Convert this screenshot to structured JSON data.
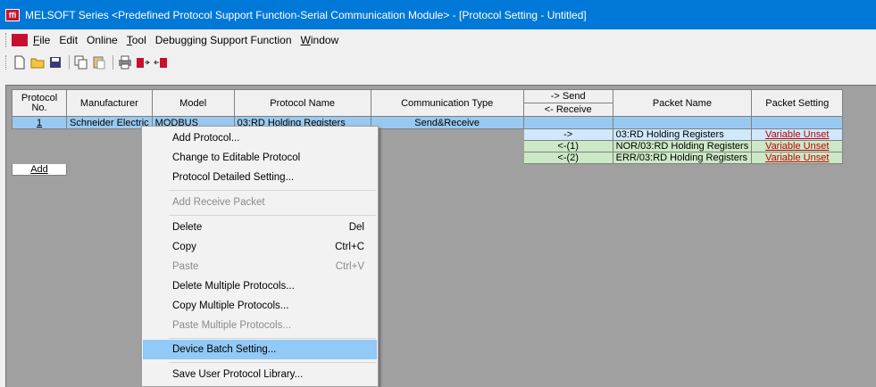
{
  "window": {
    "title": "MELSOFT Series <Predefined Protocol Support Function-Serial Communication Module> - [Protocol Setting - Untitled]",
    "icon": "melsoft-app-icon",
    "icon_glyph": "ffi"
  },
  "menubar": {
    "items": [
      {
        "key": "F",
        "rest": "ile"
      },
      {
        "key": "",
        "rest": "Edit"
      },
      {
        "key": "",
        "rest": "Online"
      },
      {
        "key": "T",
        "rest": "ool"
      },
      {
        "key": "",
        "rest": "Debugging Support Function"
      },
      {
        "key": "W",
        "rest": "indow"
      }
    ]
  },
  "toolbar": {
    "icons": [
      "new-file-icon",
      "open-folder-icon",
      "save-icon",
      "copy-icon",
      "paste-icon",
      "print-icon",
      "write-to-module-icon",
      "read-from-module-icon"
    ]
  },
  "grid": {
    "headers": {
      "no": "Protocol No.",
      "manufacturer": "Manufacturer",
      "model": "Model",
      "protocol_name": "Protocol Name",
      "comm_type": "Communication Type",
      "send": "-> Send",
      "receive": "<- Receive",
      "packet_name": "Packet Name",
      "packet_setting": "Packet Setting"
    },
    "row": {
      "no": "1",
      "manufacturer": "Schneider Electric",
      "model": "MODBUS",
      "protocol_name": "03:RD Holding Registers",
      "comm_type": "Send&Receive"
    },
    "packets": [
      {
        "dir": "->",
        "name": "03:RD Holding Registers",
        "setting": "Variable Unset"
      },
      {
        "dir": "<-(1)",
        "name": "NOR/03:RD Holding Registers",
        "setting": "Variable Unset"
      },
      {
        "dir": "<-(2)",
        "name": "ERR/03:RD Holding Registers",
        "setting": "Variable Unset"
      }
    ],
    "add_label": "Add"
  },
  "context_menu": {
    "items": [
      {
        "label": "Add Protocol...",
        "shortcut": "",
        "disabled": false
      },
      {
        "label": "Change to Editable Protocol",
        "shortcut": "",
        "disabled": false
      },
      {
        "label": "Protocol Detailed Setting...",
        "shortcut": "",
        "disabled": false
      },
      {
        "label": "Add Receive Packet",
        "shortcut": "",
        "disabled": true
      },
      {
        "label": "Delete",
        "shortcut": "Del",
        "disabled": false
      },
      {
        "label": "Copy",
        "shortcut": "Ctrl+C",
        "disabled": false
      },
      {
        "label": "Paste",
        "shortcut": "Ctrl+V",
        "disabled": true
      },
      {
        "label": "Delete Multiple Protocols...",
        "shortcut": "",
        "disabled": false
      },
      {
        "label": "Copy Multiple Protocols...",
        "shortcut": "",
        "disabled": false
      },
      {
        "label": "Paste Multiple Protocols...",
        "shortcut": "",
        "disabled": true
      },
      {
        "label": "Device Batch Setting...",
        "shortcut": "",
        "disabled": false,
        "highlighted": true
      },
      {
        "label": "Save User Protocol Library...",
        "shortcut": "",
        "disabled": false
      }
    ]
  },
  "colors": {
    "titlebar": "#0078d7",
    "selected_row": "#99c9ef",
    "send_packet": "#cfe8fb",
    "receive_packet": "#cce8c6",
    "link": "#c00000",
    "menu_highlight": "#91c9f7"
  }
}
